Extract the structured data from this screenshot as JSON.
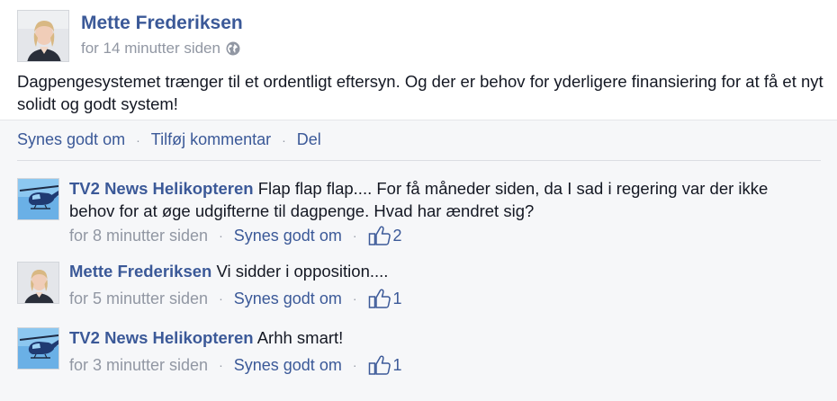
{
  "post": {
    "author": "Mette Frederiksen",
    "time": "for 14 minutter siden",
    "audience_icon": "globe-icon",
    "text": "Dagpengesystemet trænger til et ordentligt eftersyn. Og der er behov for yderligere finansiering for at få et nyt solidt og godt system!"
  },
  "actions": {
    "like": "Synes godt om",
    "comment": "Tilføj kommentar",
    "share": "Del",
    "separator": "·"
  },
  "comments": [
    {
      "author": "TV2 News Helikopteren",
      "text": "Flap flap flap....  For få måneder siden, da I sad i regering var der ikke behov for at øge udgifterne til dagpenge. Hvad har ændret sig?",
      "time": "for 8 minutter siden",
      "like_label": "Synes godt om",
      "likes": "2"
    },
    {
      "author": "Mette Frederiksen",
      "text": "Vi sidder i opposition....",
      "time": "for 5 minutter siden",
      "like_label": "Synes godt om",
      "likes": "1"
    },
    {
      "author": "TV2 News Helikopteren",
      "text": "Arhh smart!",
      "time": "for 3 minutter siden",
      "like_label": "Synes godt om",
      "likes": "1"
    }
  ],
  "colors": {
    "link_blue": "#3b5998",
    "meta_gray": "#9197a3",
    "footer_bg": "#f6f7f9"
  }
}
